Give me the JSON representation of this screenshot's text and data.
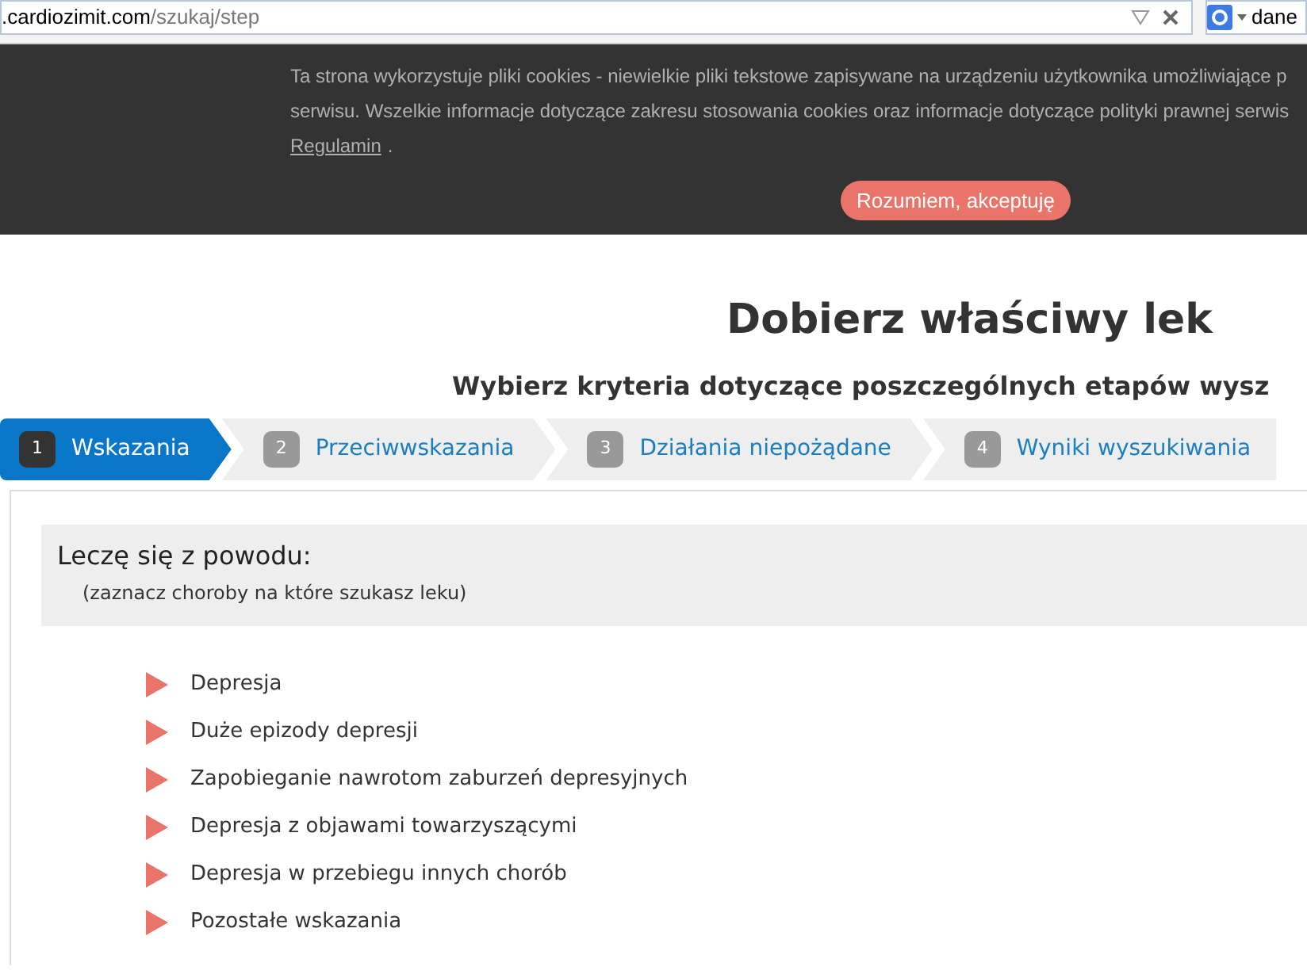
{
  "address_bar": {
    "domain": ".cardiozimit.com",
    "path": "/szukaj/step"
  },
  "browser_search": {
    "value": "dane"
  },
  "cookie_banner": {
    "lines": [
      "Ta strona wykorzystuje pliki cookies - niewielkie pliki tekstowe zapisywane na urządzeniu użytkownika umożliwiające p",
      "serwisu. Wszelkie informacje dotyczące zakresu stosowania cookies oraz informacje dotyczące polityki prawnej serwis"
    ],
    "link": "Regulamin",
    "link_suffix": ".",
    "button": "Rozumiem, akceptuję"
  },
  "title": "Dobierz właściwy lek",
  "subtitle": "Wybierz kryteria dotyczące poszczególnych etapów wysz",
  "steps": [
    {
      "number": "1",
      "label": "Wskazania",
      "selected": true
    },
    {
      "number": "2",
      "label": "Przeciwwskazania",
      "selected": false
    },
    {
      "number": "3",
      "label": "Działania niepożądane",
      "selected": false
    },
    {
      "number": "4",
      "label": "Wyniki wyszukiwania",
      "selected": false
    }
  ],
  "section": {
    "title": "Leczę się z powodu:",
    "hint": "(zaznacz choroby na które szukasz leku)"
  },
  "items": [
    "Depresja",
    "Duże epizody depresji",
    "Zapobieganie nawrotom zaburzeń depresyjnych",
    "Depresja z objawami towarzyszącymi",
    "Depresja w przebiegu innych chorób",
    "Pozostałe wskazania"
  ]
}
